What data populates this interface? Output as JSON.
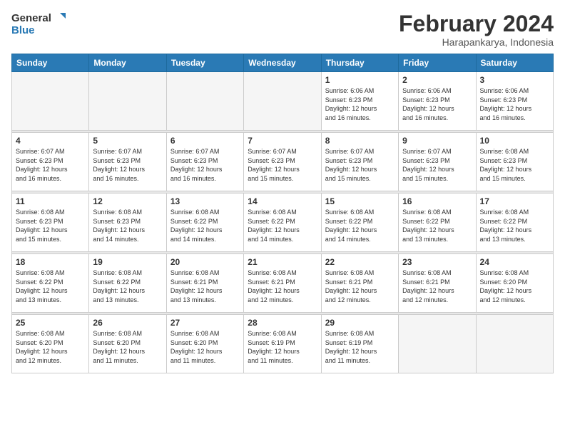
{
  "logo": {
    "line1": "General",
    "line2": "Blue"
  },
  "title": "February 2024",
  "location": "Harapankarya, Indonesia",
  "weekdays": [
    "Sunday",
    "Monday",
    "Tuesday",
    "Wednesday",
    "Thursday",
    "Friday",
    "Saturday"
  ],
  "weeks": [
    [
      {
        "day": "",
        "info": ""
      },
      {
        "day": "",
        "info": ""
      },
      {
        "day": "",
        "info": ""
      },
      {
        "day": "",
        "info": ""
      },
      {
        "day": "1",
        "info": "Sunrise: 6:06 AM\nSunset: 6:23 PM\nDaylight: 12 hours\nand 16 minutes."
      },
      {
        "day": "2",
        "info": "Sunrise: 6:06 AM\nSunset: 6:23 PM\nDaylight: 12 hours\nand 16 minutes."
      },
      {
        "day": "3",
        "info": "Sunrise: 6:06 AM\nSunset: 6:23 PM\nDaylight: 12 hours\nand 16 minutes."
      }
    ],
    [
      {
        "day": "4",
        "info": "Sunrise: 6:07 AM\nSunset: 6:23 PM\nDaylight: 12 hours\nand 16 minutes."
      },
      {
        "day": "5",
        "info": "Sunrise: 6:07 AM\nSunset: 6:23 PM\nDaylight: 12 hours\nand 16 minutes."
      },
      {
        "day": "6",
        "info": "Sunrise: 6:07 AM\nSunset: 6:23 PM\nDaylight: 12 hours\nand 16 minutes."
      },
      {
        "day": "7",
        "info": "Sunrise: 6:07 AM\nSunset: 6:23 PM\nDaylight: 12 hours\nand 15 minutes."
      },
      {
        "day": "8",
        "info": "Sunrise: 6:07 AM\nSunset: 6:23 PM\nDaylight: 12 hours\nand 15 minutes."
      },
      {
        "day": "9",
        "info": "Sunrise: 6:07 AM\nSunset: 6:23 PM\nDaylight: 12 hours\nand 15 minutes."
      },
      {
        "day": "10",
        "info": "Sunrise: 6:08 AM\nSunset: 6:23 PM\nDaylight: 12 hours\nand 15 minutes."
      }
    ],
    [
      {
        "day": "11",
        "info": "Sunrise: 6:08 AM\nSunset: 6:23 PM\nDaylight: 12 hours\nand 15 minutes."
      },
      {
        "day": "12",
        "info": "Sunrise: 6:08 AM\nSunset: 6:23 PM\nDaylight: 12 hours\nand 14 minutes."
      },
      {
        "day": "13",
        "info": "Sunrise: 6:08 AM\nSunset: 6:22 PM\nDaylight: 12 hours\nand 14 minutes."
      },
      {
        "day": "14",
        "info": "Sunrise: 6:08 AM\nSunset: 6:22 PM\nDaylight: 12 hours\nand 14 minutes."
      },
      {
        "day": "15",
        "info": "Sunrise: 6:08 AM\nSunset: 6:22 PM\nDaylight: 12 hours\nand 14 minutes."
      },
      {
        "day": "16",
        "info": "Sunrise: 6:08 AM\nSunset: 6:22 PM\nDaylight: 12 hours\nand 13 minutes."
      },
      {
        "day": "17",
        "info": "Sunrise: 6:08 AM\nSunset: 6:22 PM\nDaylight: 12 hours\nand 13 minutes."
      }
    ],
    [
      {
        "day": "18",
        "info": "Sunrise: 6:08 AM\nSunset: 6:22 PM\nDaylight: 12 hours\nand 13 minutes."
      },
      {
        "day": "19",
        "info": "Sunrise: 6:08 AM\nSunset: 6:22 PM\nDaylight: 12 hours\nand 13 minutes."
      },
      {
        "day": "20",
        "info": "Sunrise: 6:08 AM\nSunset: 6:21 PM\nDaylight: 12 hours\nand 13 minutes."
      },
      {
        "day": "21",
        "info": "Sunrise: 6:08 AM\nSunset: 6:21 PM\nDaylight: 12 hours\nand 12 minutes."
      },
      {
        "day": "22",
        "info": "Sunrise: 6:08 AM\nSunset: 6:21 PM\nDaylight: 12 hours\nand 12 minutes."
      },
      {
        "day": "23",
        "info": "Sunrise: 6:08 AM\nSunset: 6:21 PM\nDaylight: 12 hours\nand 12 minutes."
      },
      {
        "day": "24",
        "info": "Sunrise: 6:08 AM\nSunset: 6:20 PM\nDaylight: 12 hours\nand 12 minutes."
      }
    ],
    [
      {
        "day": "25",
        "info": "Sunrise: 6:08 AM\nSunset: 6:20 PM\nDaylight: 12 hours\nand 12 minutes."
      },
      {
        "day": "26",
        "info": "Sunrise: 6:08 AM\nSunset: 6:20 PM\nDaylight: 12 hours\nand 11 minutes."
      },
      {
        "day": "27",
        "info": "Sunrise: 6:08 AM\nSunset: 6:20 PM\nDaylight: 12 hours\nand 11 minutes."
      },
      {
        "day": "28",
        "info": "Sunrise: 6:08 AM\nSunset: 6:19 PM\nDaylight: 12 hours\nand 11 minutes."
      },
      {
        "day": "29",
        "info": "Sunrise: 6:08 AM\nSunset: 6:19 PM\nDaylight: 12 hours\nand 11 minutes."
      },
      {
        "day": "",
        "info": ""
      },
      {
        "day": "",
        "info": ""
      }
    ]
  ]
}
